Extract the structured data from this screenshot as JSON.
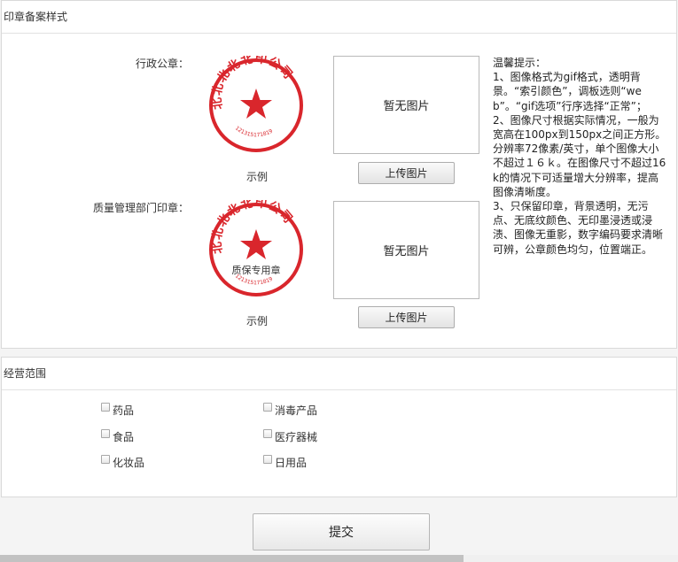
{
  "seal_section": {
    "title": "印章备案样式",
    "admin_seal": {
      "label": "行政公章：",
      "sample_caption": "示例",
      "placeholder": "暂无图片",
      "upload_label": "上传图片",
      "sample_arc_text": "北北北北北印公司",
      "sample_code": "121315171819"
    },
    "quality_seal": {
      "label": "质量管理部门印章：",
      "sample_caption": "示例",
      "placeholder": "暂无图片",
      "upload_label": "上传图片",
      "sample_arc_text": "北北北北北印公司",
      "sample_inner_text": "质保专用章",
      "sample_code": "121315171819"
    },
    "tips": [
      "温馨提示：",
      "1、图像格式为gif格式，透明背景。“索引颜色”，调板选则“web”。“gif选项”行序选择“正常”；",
      "2、图像尺寸根据实际情况，一般为宽高在100px到150px之间正方形。分辨率72像素/英寸，单个图像大小不超过１６ｋ。在图像尺寸不超过16k的情况下可适量增大分辨率，提高图像清晰度。",
      "3、只保留印章，背景透明，无污点、无底纹颜色、无印墨浸透或浸渍、图像无重影，数字编码要求清晰可辨，公章颜色均匀，位置端正。"
    ]
  },
  "scope_section": {
    "title": "经营范围",
    "items": [
      "药品",
      "消毒产品",
      "食品",
      "医疗器械",
      "化妆品",
      "日用品"
    ]
  },
  "submit_label": "提交",
  "colors": {
    "seal_red": "#d9262c",
    "border": "#d9d9d9"
  }
}
